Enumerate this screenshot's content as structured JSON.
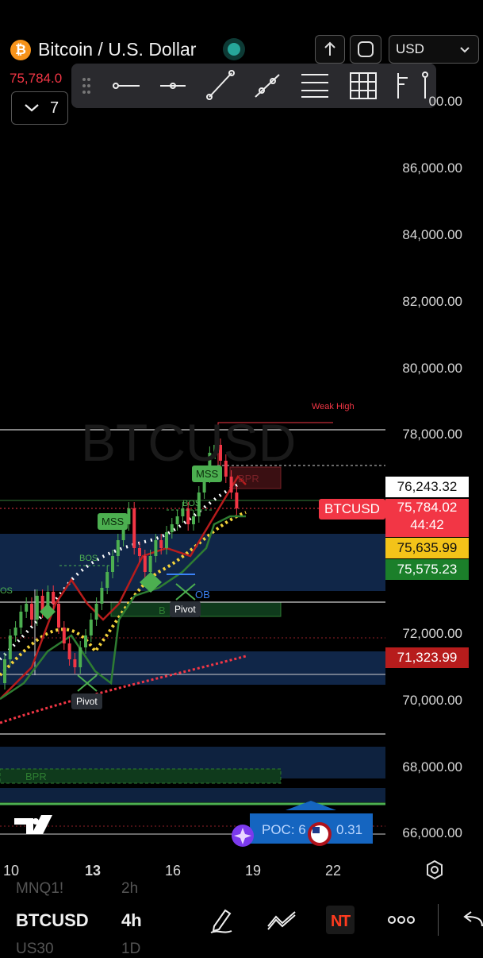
{
  "header": {
    "symbol_title": "Bitcoin / U.S. Dollar",
    "price": "75,784.0",
    "currency": "USD",
    "collapse_count": "7"
  },
  "price_axis": {
    "labels": [
      "86,000.00",
      "84,000.00",
      "82,000.00",
      "80,000.00",
      "78,000.00",
      "72,000.00",
      "70,000.00",
      "68,000.00",
      "66,000.00"
    ],
    "top_partial": "00.00"
  },
  "price_tags": {
    "t1": "76,243.32",
    "t2_price": "75,784.02",
    "t2_timer": "44:42",
    "t3": "75,635.99",
    "t4": "75,575.23",
    "t5": "71,323.99",
    "symbol_tag": "BTCUSD"
  },
  "time_axis": [
    "10",
    "13",
    "16",
    "19",
    "22"
  ],
  "annotations": {
    "watermark": "BTCUSD",
    "weak_high": "Weak High",
    "mss": "MSS",
    "bos": "BOS",
    "pivot": "Pivot",
    "bpr": "BPR",
    "ob": "OB",
    "poc": "POC: 6",
    "poc_tail": "0.31"
  },
  "bottom": {
    "ghost_top_symbol": "MNQ1!",
    "ghost_top_interval": "2h",
    "symbol": "BTCUSD",
    "interval": "4h",
    "ghost_bottom_symbol": "US30",
    "ghost_bottom_interval": "1D"
  },
  "colors": {
    "up": "#4caf50",
    "down": "#f23645",
    "zone": "#14305a",
    "accent": "#f7931a"
  }
}
